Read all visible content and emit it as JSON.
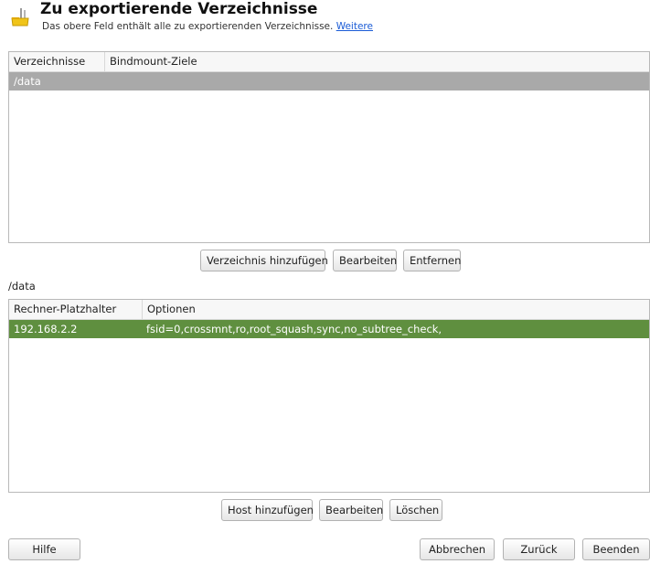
{
  "header": {
    "title": "Zu exportierende Verzeichnisse",
    "subtitle": "Das obere Feld enthält alle zu exportierenden Verzeichnisse.",
    "more_link": "Weitere"
  },
  "dir_table": {
    "columns": [
      "Verzeichnisse",
      "Bindmount-Ziele"
    ],
    "rows": [
      {
        "path": "/data",
        "bindmount": ""
      }
    ]
  },
  "dir_buttons": {
    "add": "Verzeichnis hinzufügen",
    "edit": "Bearbeiten",
    "remove": "Entfernen"
  },
  "selected_path": "/data",
  "host_table": {
    "columns": [
      "Rechner-Platzhalter",
      "Optionen"
    ],
    "rows": [
      {
        "host": "192.168.2.2",
        "options": "fsid=0,crossmnt,ro,root_squash,sync,no_subtree_check,"
      }
    ]
  },
  "host_buttons": {
    "add": "Host hinzufügen",
    "edit": "Bearbeiten",
    "delete": "Löschen"
  },
  "footer": {
    "help": "Hilfe",
    "cancel": "Abbrechen",
    "back": "Zurück",
    "finish": "Beenden"
  }
}
